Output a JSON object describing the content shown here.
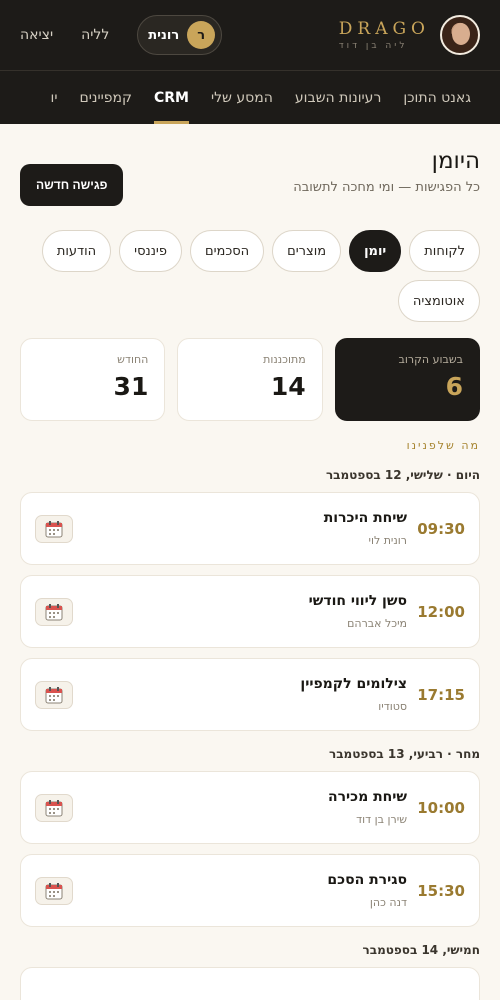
{
  "brand": {
    "name": "DRAGO",
    "subtitle": "ליה בן דוד"
  },
  "topbar": {
    "user_initial": "ר",
    "user_name": "רונית",
    "links": [
      "לליה",
      "יציאה"
    ]
  },
  "nav": {
    "tabs": [
      "גאנט התוכן",
      "רעיונות השבוע",
      "המסע שלי",
      "CRM",
      "קמפיינים",
      "יו"
    ],
    "active": "CRM"
  },
  "page": {
    "title": "היומן",
    "subtitle": "כל הפגישות — ומי מחכה לתשובה",
    "new_button": "פגישה חדשה"
  },
  "filters": {
    "chips": [
      "לקוחות",
      "יומן",
      "מוצרים",
      "הסכמים",
      "פיננסי",
      "הודעות",
      "אוטומציה"
    ],
    "active": "יומן"
  },
  "stats": [
    {
      "label": "בשבוע הקרוב",
      "value": "6"
    },
    {
      "label": "מתוכננות",
      "value": "14"
    },
    {
      "label": "החודש",
      "value": "31"
    }
  ],
  "section_kicker": "מה שלפנינו",
  "days": [
    {
      "title": "היום · שלישי, 12 בספטמבר",
      "events": [
        {
          "time": "09:30",
          "title": "שיחת היכרות",
          "subtitle": "רונית לוי"
        },
        {
          "time": "12:00",
          "title": "סשן ליווי חודשי",
          "subtitle": "מיכל אברהם"
        },
        {
          "time": "17:15",
          "title": "צילומים לקמפיין",
          "subtitle": "סטודיו"
        }
      ]
    },
    {
      "title": "מחר · רביעי, 13 בספטמבר",
      "events": [
        {
          "time": "10:00",
          "title": "שיחת מכירה",
          "subtitle": "שירן בן דוד"
        },
        {
          "time": "15:30",
          "title": "סגירת הסכם",
          "subtitle": "דנה כהן"
        }
      ]
    },
    {
      "title": "חמישי, 14 בספטמבר",
      "events": []
    }
  ],
  "icons": {
    "calendar": "calendar-icon"
  },
  "colors": {
    "accent": "#c9a55a",
    "dark": "#1d1b18",
    "background": "#faf7f1"
  }
}
